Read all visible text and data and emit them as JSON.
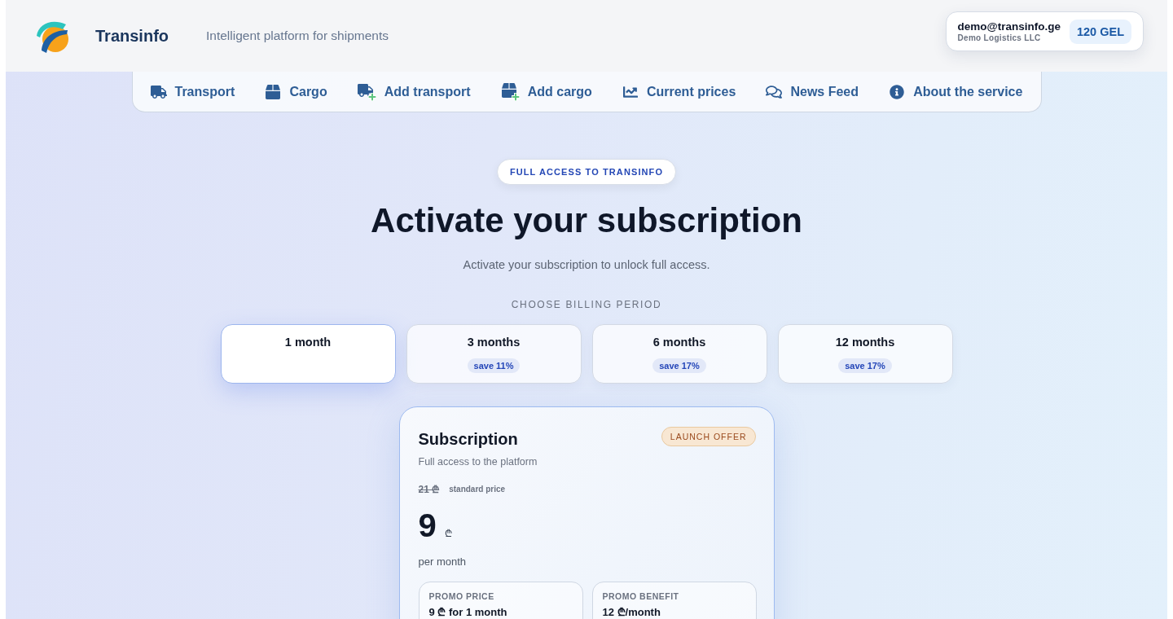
{
  "header": {
    "brand": "Transinfo",
    "tagline": "Intelligent platform for shipments",
    "account": {
      "email": "demo@transinfo.ge",
      "company": "Demo Logistics LLC",
      "balance": "120 GEL"
    }
  },
  "nav": {
    "items": [
      {
        "label": "Transport"
      },
      {
        "label": "Cargo"
      },
      {
        "label": "Add transport"
      },
      {
        "label": "Add cargo"
      },
      {
        "label": "Current prices"
      },
      {
        "label": "News Feed"
      },
      {
        "label": "About the service"
      }
    ]
  },
  "hero": {
    "badge": "FULL ACCESS TO TRANSINFO",
    "title": "Activate your subscription",
    "subtitle": "Activate your subscription to unlock full access."
  },
  "billing": {
    "label": "CHOOSE BILLING PERIOD",
    "periods": [
      {
        "label": "1 month",
        "selected": true
      },
      {
        "label": "3 months",
        "saving": "save 11%",
        "selected": false
      },
      {
        "label": "6 months",
        "saving": "save 17%",
        "selected": false
      },
      {
        "label": "12 months",
        "saving": "save 17%",
        "selected": false
      }
    ]
  },
  "plan": {
    "title": "Subscription",
    "badge": "LAUNCH OFFER",
    "description": "Full access to the platform",
    "old_price": "21 ₾",
    "old_price_note": "standard price",
    "price": "9",
    "currency": "₾",
    "period": "per month",
    "details": [
      {
        "label": "PROMO PRICE",
        "value": "9 ₾ for 1 month"
      },
      {
        "label": "PROMO BENEFIT",
        "value": "12 ₾/month"
      }
    ]
  }
}
